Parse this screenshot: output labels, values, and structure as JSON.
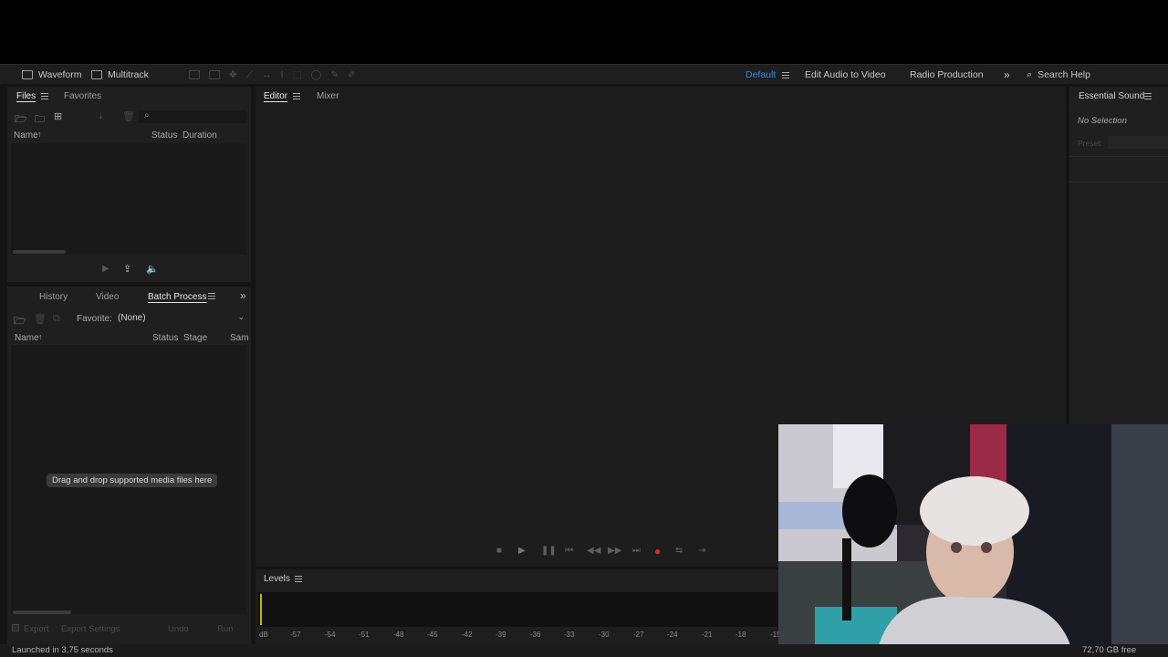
{
  "toolbar": {
    "waveform_label": "Waveform",
    "multitrack_label": "Multitrack",
    "workspaces": [
      "Default",
      "Edit Audio to Video",
      "Radio Production"
    ],
    "search_placeholder": "Search Help",
    "accent_color": "#2d8ceb"
  },
  "files_panel": {
    "tabs": [
      "Files",
      "Favorites"
    ],
    "columns": [
      "Name",
      "Status",
      "Duration"
    ]
  },
  "batch_panel": {
    "tabs": [
      "History",
      "Video",
      "Batch Process"
    ],
    "favorite_label": "Favorite:",
    "favorite_value": "(None)",
    "columns": [
      "Name",
      "Status",
      "Stage",
      "Sam"
    ],
    "drop_hint": "Drag and drop supported media files here",
    "buttons": [
      "Export",
      "Export Settings",
      "Undo",
      "Run"
    ]
  },
  "editor": {
    "tabs": [
      "Editor",
      "Mixer"
    ]
  },
  "levels": {
    "title": "Levels",
    "ticks": [
      "dB",
      "-57",
      "-54",
      "-51",
      "-48",
      "-45",
      "-42",
      "-39",
      "-36",
      "-33",
      "-30",
      "-27",
      "-24",
      "-21",
      "-18",
      "-15"
    ]
  },
  "essential_sound": {
    "title": "Essential Sound",
    "no_selection": "No Selection",
    "preset_label": "Preset:"
  },
  "status_bar": {
    "launch_text": "Launched in 3,75 seconds",
    "free_space": "72,70 GB free"
  }
}
